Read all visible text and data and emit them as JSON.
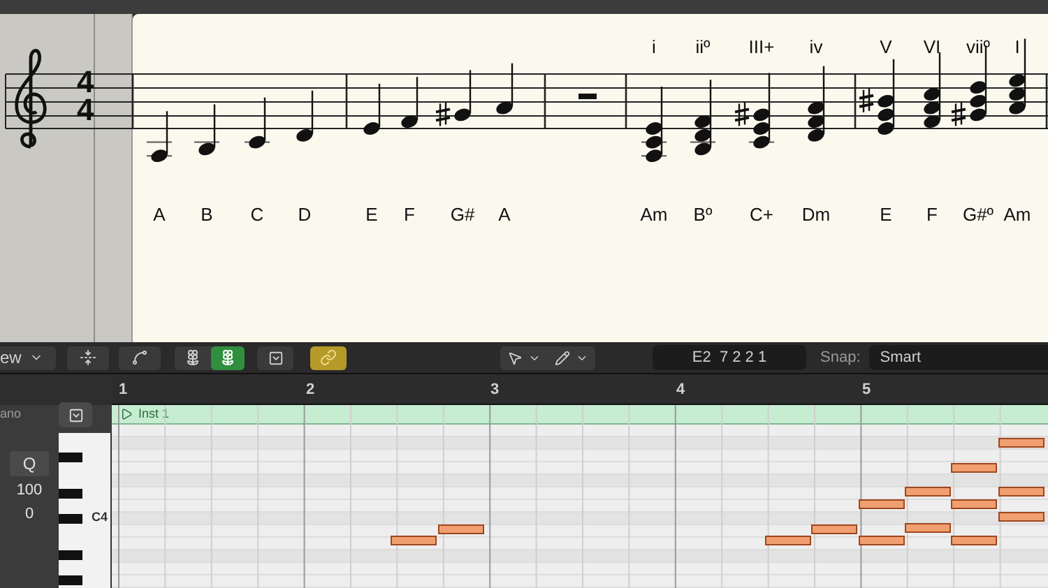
{
  "score": {
    "time_signature": [
      "4",
      "4"
    ],
    "scale_notes": [
      "A",
      "B",
      "C",
      "D",
      "E",
      "F",
      "G#",
      "A"
    ],
    "chord_numerals": [
      "i",
      "iiº",
      "III+",
      "iv",
      "V",
      "VI",
      "viiº",
      "I"
    ],
    "chord_names": [
      "Am",
      "Bº",
      "C+",
      "Dm",
      "E",
      "F",
      "G#º",
      "Am"
    ]
  },
  "toolbar": {
    "view_menu": "ew",
    "midi_in_on": true,
    "link_on": true,
    "position_display": "E2  7 2 2 1",
    "snap_label": "Snap:",
    "snap_value": "Smart"
  },
  "ruler": [
    "1",
    "2",
    "3",
    "4",
    "5"
  ],
  "track_header": {
    "name": "ano",
    "quantize": "Q",
    "velocity": "100",
    "value": "0"
  },
  "piano_roll": {
    "key_label": "C4",
    "region_name": "Inst 1"
  }
}
